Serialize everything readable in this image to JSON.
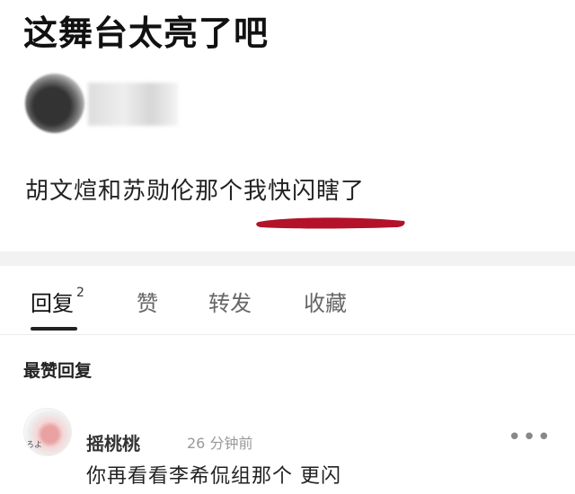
{
  "post": {
    "title": "这舞台太亮了吧",
    "text": "胡文煊和苏勋伦那个我快闪瞎了"
  },
  "colors": {
    "underline_mark": "#b3122a",
    "active_tab": "#111111",
    "muted": "#999999"
  },
  "tabs": [
    {
      "label": "回复",
      "count": "2",
      "active": true
    },
    {
      "label": "赞"
    },
    {
      "label": "转发"
    },
    {
      "label": "收藏"
    }
  ],
  "section": {
    "title": "最赞回复"
  },
  "comment": {
    "username": "摇桃桃",
    "avatar_tag": "ろよ",
    "time": "26 分钟前",
    "text": "你再看看李希侃组那个 更闪",
    "more_icon": "more-horizontal-icon",
    "more_glyph": "•••"
  }
}
